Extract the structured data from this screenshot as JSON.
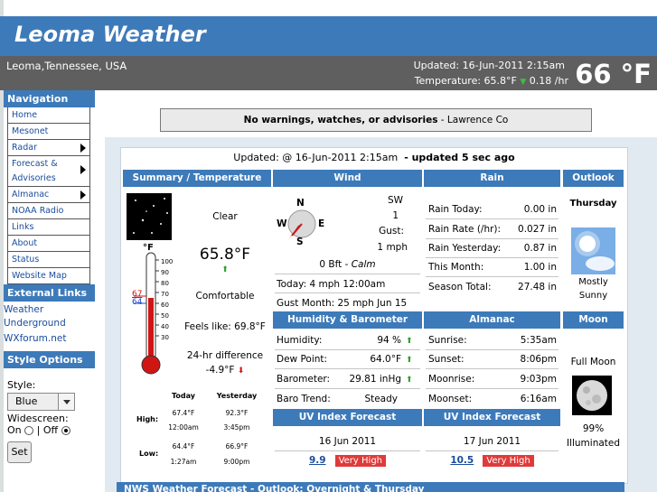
{
  "header": {
    "title": "Leoma Weather"
  },
  "subbar": {
    "location": "Leoma,Tennessee, USA",
    "updated": "Updated:  16-Jun-2011 2:15am",
    "temp_line": "Temperature: 65.8°F",
    "temp_rate": "0.18 /hr",
    "big_temp": "66 °F"
  },
  "sidebar": {
    "nav_title": "Navigation",
    "nav_items": [
      {
        "label": "Home"
      },
      {
        "label": "Mesonet"
      },
      {
        "label": "Radar"
      },
      {
        "label": "Forecast &"
      },
      {
        "label": "Advisories"
      },
      {
        "label": "Almanac"
      },
      {
        "label": "NOAA Radio"
      },
      {
        "label": "Links"
      },
      {
        "label": "About"
      },
      {
        "label": "Status"
      },
      {
        "label": "Website Map"
      }
    ],
    "ext_title": "External Links",
    "ext_links": [
      {
        "label": "Weather"
      },
      {
        "label": "Underground"
      },
      {
        "label": "WXforum.net"
      }
    ],
    "style_title": "Style Options",
    "style_label": "Style:",
    "style_value": "Blue",
    "widescreen_label": "Widescreen:",
    "on_label": "On",
    "off_label": "| Off",
    "set_label": "Set"
  },
  "warning": {
    "bold": "No warnings, watches, or advisories",
    "rest": " - Lawrence Co"
  },
  "dash": {
    "updated": "Updated: @ 16-Jun-2011 2:15am",
    "updated_ago": "- updated 5 sec ago",
    "heads": {
      "summary": "Summary / Temperature",
      "wind": "Wind",
      "rain": "Rain",
      "outlook": "Outlook",
      "humbar": "Humidity & Barometer",
      "almanac": "Almanac",
      "moon": "Moon",
      "uv1": "UV Index Forecast",
      "uv2": "UV Index Forecast"
    },
    "summary": {
      "condition": "Clear",
      "temp": "65.8°F",
      "comfort": "Comfortable",
      "feels": "Feels like: 69.8°F",
      "diff_label": "24-hr difference",
      "diff_val": "-4.9°F",
      "thermo_hi": "67",
      "thermo_lo": "64",
      "thermo_unit": "°F",
      "scale": [
        "100",
        "90",
        "80",
        "70",
        "60",
        "50",
        "40",
        "30"
      ],
      "hl_today": "Today",
      "hl_yest": "Yesterday",
      "high": "High:",
      "low": "Low:",
      "high_today": "67.4°F",
      "high_today_t": "12:00am",
      "high_yest": "92.3°F",
      "high_yest_t": "3:45pm",
      "low_today": "64.4°F",
      "low_today_t": "1:27am",
      "low_yest": "66.9°F",
      "low_yest_t": "9:00pm"
    },
    "wind": {
      "dir": "SW",
      "speed": "1",
      "gust_label": "Gust:",
      "gust": "1 mph",
      "bft": "0 Bft - ",
      "calm": "Calm",
      "today": "Today: 4 mph 12:00am",
      "month": "Gust Month: 25 mph Jun 15",
      "n": "N",
      "s": "S",
      "e": "E",
      "w": "W"
    },
    "rain": [
      {
        "label": "Rain Today:",
        "val": "0.00 in"
      },
      {
        "label": "Rain Rate (/hr):",
        "val": "0.027 in"
      },
      {
        "label": "Rain Yesterday:",
        "val": "0.87 in"
      },
      {
        "label": "This Month:",
        "val": "1.00 in"
      },
      {
        "label": "Season Total:",
        "val": "27.48 in"
      }
    ],
    "outlook": {
      "day": "Thursday",
      "cond1": "Mostly",
      "cond2": "Sunny"
    },
    "humbar": [
      {
        "label": "Humidity:",
        "val": "94 %"
      },
      {
        "label": "Dew Point:",
        "val": "64.0°F"
      },
      {
        "label": "Barometer:",
        "val": "29.81 inHg"
      },
      {
        "label": "Baro Trend:",
        "val": "Steady"
      }
    ],
    "almanac": [
      {
        "label": "Sunrise:",
        "val": "5:35am"
      },
      {
        "label": "Sunset:",
        "val": "8:06pm"
      },
      {
        "label": "Moonrise:",
        "val": "9:03pm"
      },
      {
        "label": "Moonset:",
        "val": "6:16am"
      }
    ],
    "moon": {
      "phase": "Full Moon",
      "pct": "99%",
      "illum": "Illuminated"
    },
    "uv1": {
      "date": "16 Jun 2011",
      "val": "9.9",
      "level": "Very High"
    },
    "uv2": {
      "date": "17 Jun 2011",
      "val": "10.5",
      "level": "Very High"
    }
  },
  "forecast_bar": "NWS Weather Forecast - Outlook: Overnight & Thursday",
  "colors": {
    "accent": "#3d7ab9",
    "subbar": "#5f5f5f",
    "very_high": "#e03a3a"
  }
}
